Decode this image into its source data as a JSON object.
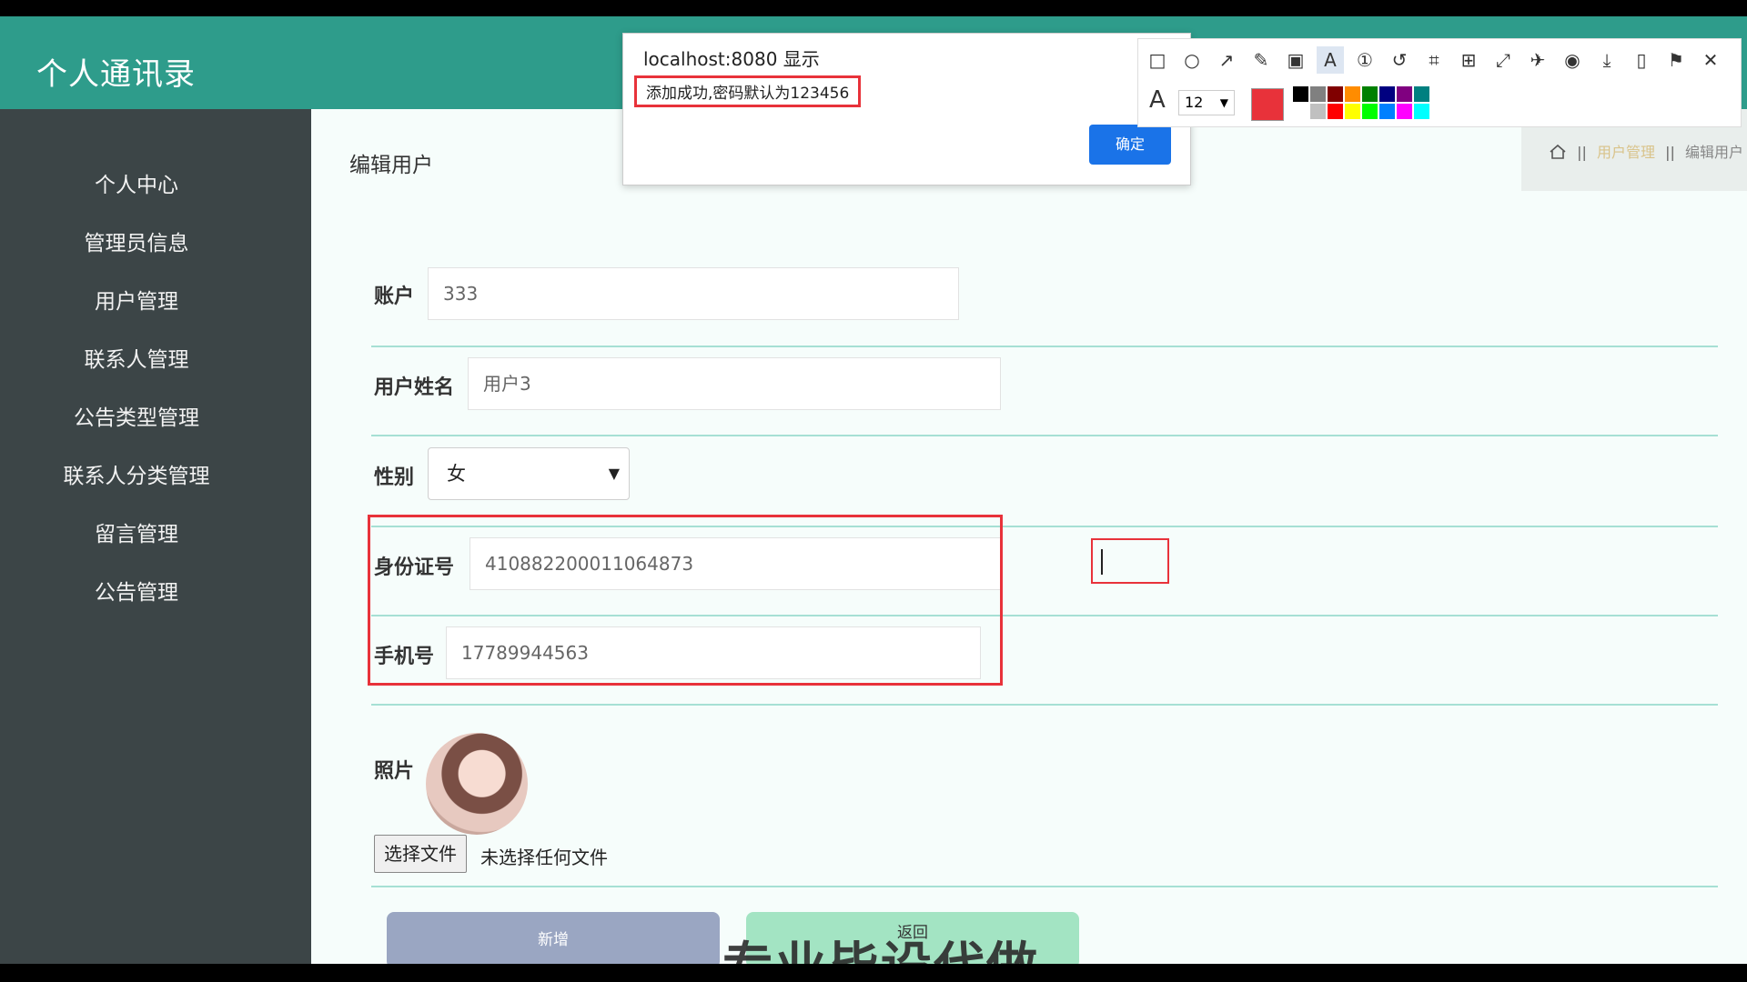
{
  "header": {
    "app_title": "个人通讯录",
    "icons": [
      "close-x-icon",
      "user-icon"
    ],
    "colors": {
      "bar": "#2e9c8b",
      "icon_bg": "#2dc3c8"
    }
  },
  "sidebar": {
    "items": [
      {
        "label": "个人中心"
      },
      {
        "label": "管理员信息"
      },
      {
        "label": "用户管理"
      },
      {
        "label": "联系人管理"
      },
      {
        "label": "公告类型管理"
      },
      {
        "label": "联系人分类管理"
      },
      {
        "label": "留言管理"
      },
      {
        "label": "公告管理"
      }
    ]
  },
  "main": {
    "page_title": "编辑用户",
    "breadcrumb": {
      "section": "用户管理",
      "current": "编辑用户",
      "separator": "||"
    }
  },
  "form": {
    "account": {
      "label": "账户",
      "value": "333"
    },
    "username": {
      "label": "用户姓名",
      "value": "用户3"
    },
    "gender": {
      "label": "性别",
      "value": "女"
    },
    "id_number": {
      "label": "身份证号",
      "value": "410882200011064873"
    },
    "phone": {
      "label": "手机号",
      "value": "17789944563"
    },
    "photo": {
      "label": "照片",
      "choose_file": "选择文件",
      "no_file": "未选择任何文件"
    },
    "buttons": {
      "add": "新增",
      "back": "返回"
    }
  },
  "watermark": "专业毕设代做",
  "dialog": {
    "title": "localhost:8080 显示",
    "message": "添加成功,密码默认为123456",
    "ok": "确定"
  },
  "annotation_toolbar": {
    "tools": [
      "rectangle-icon",
      "circle-icon",
      "arrow-icon",
      "pencil-icon",
      "mosaic-icon",
      "text-icon",
      "number-icon",
      "undo-icon",
      "crop-icon",
      "ocr-icon",
      "expand-icon",
      "pin-icon",
      "record-icon",
      "download-icon",
      "save-icon",
      "bookmark-icon",
      "close-icon"
    ],
    "active_tool": "text-icon",
    "font_size": "12",
    "current_color": "#e8323a",
    "palette_top": [
      "#000000",
      "#808080",
      "#800000",
      "#ff8c00",
      "#008000",
      "#000080",
      "#800080",
      "#008080"
    ],
    "palette_bottom": [
      "#ffffff",
      "#c0c0c0",
      "#ff0000",
      "#ffff00",
      "#00ff00",
      "#0080ff",
      "#ff00ff",
      "#00ffff"
    ]
  }
}
